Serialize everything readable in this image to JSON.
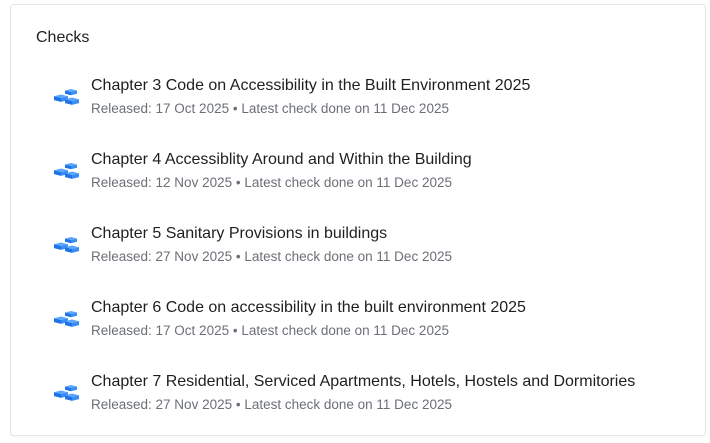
{
  "section": {
    "heading": "Checks"
  },
  "colors": {
    "icon_top": "#5aa7ff",
    "icon_left": "#1f73e6",
    "icon_right": "#3b8cf5"
  },
  "checks": [
    {
      "icon": "cube-stack-icon",
      "title": "Chapter 3 Code on Accessibility in the Built Environment 2025",
      "meta": "Released: 17 Oct 2025 • Latest check done on 11 Dec 2025"
    },
    {
      "icon": "cube-stack-icon",
      "title": "Chapter 4 Accessiblity Around and Within the Building",
      "meta": "Released: 12 Nov 2025 • Latest check done on 11 Dec 2025"
    },
    {
      "icon": "cube-stack-icon",
      "title": "Chapter 5 Sanitary Provisions in buildings",
      "meta": "Released: 27 Nov 2025 • Latest check done on 11 Dec 2025"
    },
    {
      "icon": "cube-stack-icon",
      "title": "Chapter 6 Code on accessibility in the built environment 2025",
      "meta": "Released: 17 Oct 2025 • Latest check done on 11 Dec 2025"
    },
    {
      "icon": "cube-stack-icon",
      "title": "Chapter 7 Residential, Serviced Apartments, Hotels, Hostels and Dormitories",
      "meta": "Released: 27 Nov 2025 • Latest check done on 11 Dec 2025"
    }
  ]
}
